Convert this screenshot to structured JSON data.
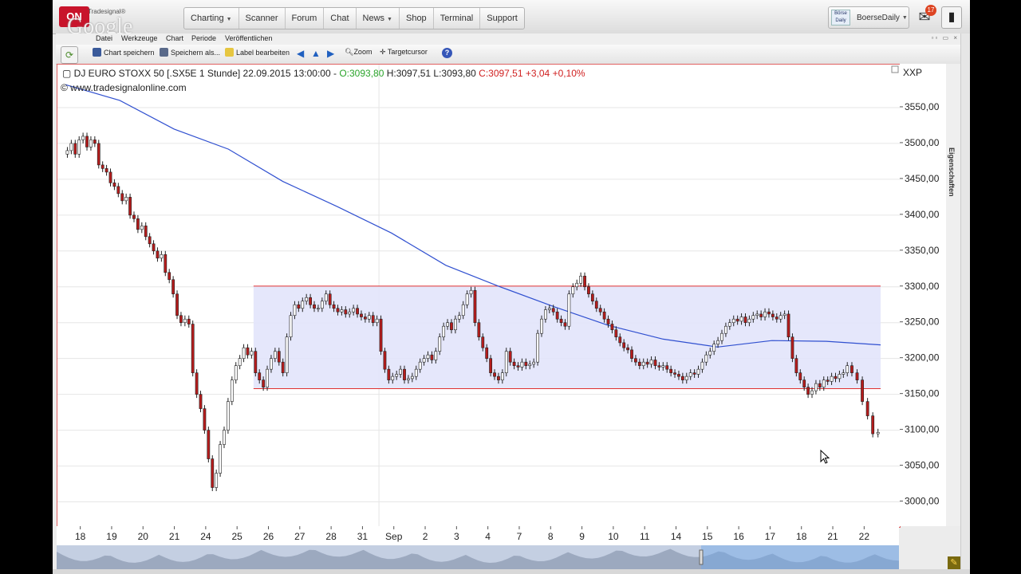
{
  "brand": {
    "logo_text": "ON",
    "logo_sub": "Tradesignal®",
    "overlay_text": "Google"
  },
  "nav": [
    {
      "label": "Charting",
      "has_caret": true
    },
    {
      "label": "Scanner",
      "has_caret": false
    },
    {
      "label": "Forum",
      "has_caret": false
    },
    {
      "label": "Chat",
      "has_caret": false
    },
    {
      "label": "News",
      "has_caret": true
    },
    {
      "label": "Shop",
      "has_caret": false
    },
    {
      "label": "Terminal",
      "has_caret": false
    },
    {
      "label": "Support",
      "has_caret": false
    }
  ],
  "user": {
    "avatar_text": "Börse Daily",
    "name": "BoerseDaily",
    "mail_count": "17"
  },
  "menu": [
    "Datei",
    "Werkzeuge",
    "Chart",
    "Periode",
    "Veröffentlichen"
  ],
  "toolbar": {
    "save": "Chart speichern",
    "save_as": "Speichern als...",
    "label_edit": "Label bearbeiten",
    "zoom": "Zoom",
    "target": "Targetcursor",
    "help": "?"
  },
  "chart_header": {
    "instrument": "DJ EURO STOXX 50 [.SX5E  1 Stunde] 22.09.2015 13:00:00 - ",
    "open": "O:3093,80",
    "high": "H:3097,51",
    "low": "L:3093,80",
    "close": "C:3097,51",
    "change": "+3,04 +0,10%",
    "copyright": "© www.tradesignalonline.com",
    "symbol": "XXP"
  },
  "side_tab": "Eigenschaften",
  "colors": {
    "up": "#ffffff",
    "down": "#b51c1c",
    "open_green": "#2aa42a",
    "close_red": "#d02020",
    "ma": "#3050d0",
    "box_fill": "#e2e4fb",
    "box_line": "#e03030"
  },
  "chart_data": {
    "type": "candlestick",
    "title": "DJ EURO STOXX 50 [.SX5E  1 Stunde]",
    "interval": "1 Stunde",
    "ylim": [
      2965,
      3610
    ],
    "y_ticks": [
      "3550,00",
      "3500,00",
      "3450,00",
      "3400,00",
      "3350,00",
      "3300,00",
      "3250,00",
      "3200,00",
      "3150,00",
      "3100,00",
      "3050,00",
      "3000,00"
    ],
    "x_ticks": [
      "18",
      "19",
      "20",
      "21",
      "24",
      "25",
      "26",
      "27",
      "28",
      "31",
      "Sep",
      "2",
      "3",
      "4",
      "7",
      "8",
      "9",
      "10",
      "11",
      "14",
      "15",
      "16",
      "17",
      "18",
      "21",
      "22"
    ],
    "grid": true,
    "annotations": {
      "range_box": {
        "upper": 3301,
        "lower": 3158,
        "start_session": 6,
        "end_session": 26
      },
      "moving_average": [
        3582,
        3560,
        3520,
        3492,
        3447,
        3412,
        3375,
        3330,
        3300,
        3272,
        3246,
        3227,
        3216,
        3225,
        3224,
        3219
      ]
    },
    "series": [
      {
        "values": [
          [
            3490,
            3500,
            3485,
            3505,
            3510,
            3495,
            3505,
            3500
          ],
          [
            3470,
            3465,
            3460,
            3445,
            3440,
            3430,
            3420,
            3425
          ],
          [
            3400,
            3395,
            3380,
            3385,
            3370,
            3360,
            3350,
            3340
          ],
          [
            3345,
            3320,
            3310,
            3290,
            3260,
            3250,
            3255,
            3248
          ],
          [
            3180,
            3150,
            3130,
            3100,
            3060,
            3020,
            3040,
            3080
          ],
          [
            3100,
            3140,
            3170,
            3190,
            3200,
            3215,
            3205,
            3210
          ],
          [
            3180,
            3170,
            3160,
            3185,
            3200,
            3210,
            3195,
            3180
          ],
          [
            3230,
            3260,
            3275,
            3270,
            3280,
            3285,
            3275,
            3270
          ],
          [
            3270,
            3280,
            3290,
            3275,
            3270,
            3265,
            3268,
            3262
          ],
          [
            3265,
            3270,
            3262,
            3258,
            3255,
            3260,
            3250,
            3255
          ],
          [
            3210,
            3185,
            3170,
            3175,
            3178,
            3185,
            3170,
            3172
          ],
          [
            3175,
            3185,
            3195,
            3200,
            3205,
            3198,
            3210,
            3230
          ],
          [
            3245,
            3250,
            3240,
            3255,
            3260,
            3275,
            3290,
            3295
          ],
          [
            3250,
            3230,
            3215,
            3200,
            3180,
            3175,
            3170,
            3180
          ],
          [
            3210,
            3195,
            3190,
            3188,
            3195,
            3190,
            3192,
            3195
          ],
          [
            3235,
            3255,
            3268,
            3270,
            3265,
            3255,
            3250,
            3245
          ],
          [
            3290,
            3300,
            3305,
            3315,
            3300,
            3290,
            3280,
            3270
          ],
          [
            3265,
            3255,
            3248,
            3240,
            3230,
            3222,
            3215,
            3212
          ],
          [
            3200,
            3195,
            3190,
            3195,
            3192,
            3198,
            3190,
            3188
          ],
          [
            3190,
            3185,
            3180,
            3178,
            3175,
            3170,
            3175,
            3180
          ],
          [
            3178,
            3185,
            3195,
            3205,
            3210,
            3220,
            3225,
            3235
          ],
          [
            3245,
            3250,
            3255,
            3252,
            3258,
            3250,
            3255,
            3260
          ],
          [
            3262,
            3258,
            3265,
            3262,
            3258,
            3255,
            3260,
            3262
          ],
          [
            3230,
            3200,
            3180,
            3170,
            3160,
            3150,
            3155,
            3165
          ],
          [
            3160,
            3170,
            3168,
            3175,
            3172,
            3178,
            3180,
            3190
          ],
          [
            3180,
            3170,
            3140,
            3120,
            3095,
            3097
          ]
        ]
      }
    ]
  }
}
